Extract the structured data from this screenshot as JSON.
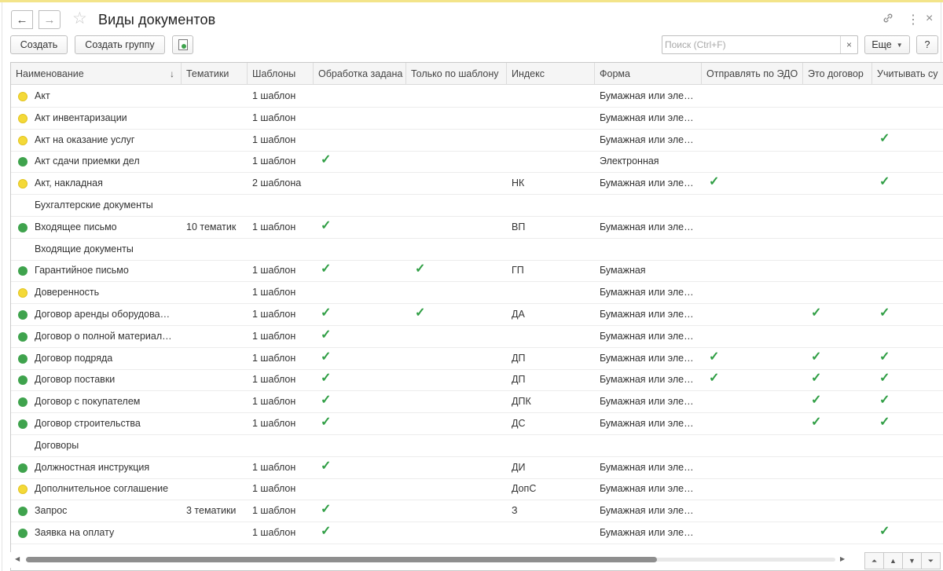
{
  "window": {
    "title": "Виды документов"
  },
  "toolbar": {
    "create_label": "Создать",
    "create_group_label": "Создать группу",
    "search_placeholder": "Поиск (Ctrl+F)",
    "search_clear": "×",
    "more_label": "Еще",
    "help_label": "?"
  },
  "icons": {
    "back": "←",
    "forward": "→",
    "favorite": "☆",
    "link": "🔗",
    "more": "⋮",
    "close": "×",
    "sort": "↓",
    "check": "✓"
  },
  "colors": {
    "status_yellow": "#f4d938",
    "status_green": "#3fa34d",
    "check_green": "#2f9e44"
  },
  "columns": [
    {
      "key": "name",
      "label": "Наименование"
    },
    {
      "key": "topics",
      "label": "Тематики"
    },
    {
      "key": "templates",
      "label": "Шаблоны"
    },
    {
      "key": "processing",
      "label": "Обработка задана"
    },
    {
      "key": "by_template",
      "label": "Только по шаблону"
    },
    {
      "key": "index",
      "label": "Индекс"
    },
    {
      "key": "form",
      "label": "Форма"
    },
    {
      "key": "edo",
      "label": "Отправлять по ЭДО"
    },
    {
      "key": "contract",
      "label": "Это договор"
    },
    {
      "key": "account",
      "label": "Учитывать су"
    }
  ],
  "rows": [
    {
      "status": "yellow",
      "name": "Акт",
      "topics": "",
      "templates": "1 шаблон",
      "processing": false,
      "by_template": false,
      "index": "",
      "form": "Бумажная или эле…",
      "edo": false,
      "contract": false,
      "account": false
    },
    {
      "status": "yellow",
      "name": "Акт инвентаризации",
      "topics": "",
      "templates": "1 шаблон",
      "processing": false,
      "by_template": false,
      "index": "",
      "form": "Бумажная или эле…",
      "edo": false,
      "contract": false,
      "account": false
    },
    {
      "status": "yellow",
      "name": "Акт на оказание услуг",
      "topics": "",
      "templates": "1 шаблон",
      "processing": false,
      "by_template": false,
      "index": "",
      "form": "Бумажная или эле…",
      "edo": false,
      "contract": false,
      "account": true
    },
    {
      "status": "green",
      "name": "Акт сдачи приемки дел",
      "topics": "",
      "templates": "1 шаблон",
      "processing": true,
      "by_template": false,
      "index": "",
      "form": "Электронная",
      "edo": false,
      "contract": false,
      "account": false
    },
    {
      "status": "yellow",
      "name": "Акт, накладная",
      "topics": "",
      "templates": "2 шаблона",
      "processing": false,
      "by_template": false,
      "index": "НК",
      "form": "Бумажная или эле…",
      "edo": true,
      "contract": false,
      "account": true
    },
    {
      "status": "none",
      "name": "Бухгалтерские документы",
      "topics": "",
      "templates": "",
      "processing": false,
      "by_template": false,
      "index": "",
      "form": "",
      "edo": false,
      "contract": false,
      "account": false
    },
    {
      "status": "green",
      "name": "Входящее письмо",
      "topics": "10 тематик",
      "templates": "1 шаблон",
      "processing": true,
      "by_template": false,
      "index": "ВП",
      "form": "Бумажная или эле…",
      "edo": false,
      "contract": false,
      "account": false
    },
    {
      "status": "none",
      "name": "Входящие документы",
      "topics": "",
      "templates": "",
      "processing": false,
      "by_template": false,
      "index": "",
      "form": "",
      "edo": false,
      "contract": false,
      "account": false
    },
    {
      "status": "green",
      "name": "Гарантийное письмо",
      "topics": "",
      "templates": "1 шаблон",
      "processing": true,
      "by_template": true,
      "index": "ГП",
      "form": "Бумажная",
      "edo": false,
      "contract": false,
      "account": false
    },
    {
      "status": "yellow",
      "name": "Доверенность",
      "topics": "",
      "templates": "1 шаблон",
      "processing": false,
      "by_template": false,
      "index": "",
      "form": "Бумажная или эле…",
      "edo": false,
      "contract": false,
      "account": false
    },
    {
      "status": "green",
      "name": "Договор аренды оборудова…",
      "topics": "",
      "templates": "1 шаблон",
      "processing": true,
      "by_template": true,
      "index": "ДА",
      "form": "Бумажная или эле…",
      "edo": false,
      "contract": true,
      "account": true
    },
    {
      "status": "green",
      "name": "Договор о полной материал…",
      "topics": "",
      "templates": "1 шаблон",
      "processing": true,
      "by_template": false,
      "index": "",
      "form": "Бумажная или эле…",
      "edo": false,
      "contract": false,
      "account": false
    },
    {
      "status": "green",
      "name": "Договор подряда",
      "topics": "",
      "templates": "1 шаблон",
      "processing": true,
      "by_template": false,
      "index": "ДП",
      "form": "Бумажная или эле…",
      "edo": true,
      "contract": true,
      "account": true
    },
    {
      "status": "green",
      "name": "Договор поставки",
      "topics": "",
      "templates": "1 шаблон",
      "processing": true,
      "by_template": false,
      "index": "ДП",
      "form": "Бумажная или эле…",
      "edo": true,
      "contract": true,
      "account": true
    },
    {
      "status": "green",
      "name": "Договор с покупателем",
      "topics": "",
      "templates": "1 шаблон",
      "processing": true,
      "by_template": false,
      "index": "ДПК",
      "form": "Бумажная или эле…",
      "edo": false,
      "contract": true,
      "account": true
    },
    {
      "status": "green",
      "name": "Договор строительства",
      "topics": "",
      "templates": "1 шаблон",
      "processing": true,
      "by_template": false,
      "index": "ДС",
      "form": "Бумажная или эле…",
      "edo": false,
      "contract": true,
      "account": true
    },
    {
      "status": "none",
      "name": "Договоры",
      "topics": "",
      "templates": "",
      "processing": false,
      "by_template": false,
      "index": "",
      "form": "",
      "edo": false,
      "contract": false,
      "account": false
    },
    {
      "status": "green",
      "name": "Должностная инструкция",
      "topics": "",
      "templates": "1 шаблон",
      "processing": true,
      "by_template": false,
      "index": "ДИ",
      "form": "Бумажная или эле…",
      "edo": false,
      "contract": false,
      "account": false
    },
    {
      "status": "yellow",
      "name": "Дополнительное соглашение",
      "topics": "",
      "templates": "1 шаблон",
      "processing": false,
      "by_template": false,
      "index": "ДопС",
      "form": "Бумажная или эле…",
      "edo": false,
      "contract": false,
      "account": false
    },
    {
      "status": "green",
      "name": "Запрос",
      "topics": "3 тематики",
      "templates": "1 шаблон",
      "processing": true,
      "by_template": false,
      "index": "З",
      "form": "Бумажная или эле…",
      "edo": false,
      "contract": false,
      "account": false
    },
    {
      "status": "green",
      "name": "Заявка на оплату",
      "topics": "",
      "templates": "1 шаблон",
      "processing": true,
      "by_template": false,
      "index": "",
      "form": "Бумажная или эле…",
      "edo": false,
      "contract": false,
      "account": true
    }
  ],
  "scroll": {
    "left_arrow": "◀",
    "right_arrow": "▶",
    "nav_first": "⏶",
    "nav_up": "▲",
    "nav_down": "▼",
    "nav_last": "⏷"
  }
}
